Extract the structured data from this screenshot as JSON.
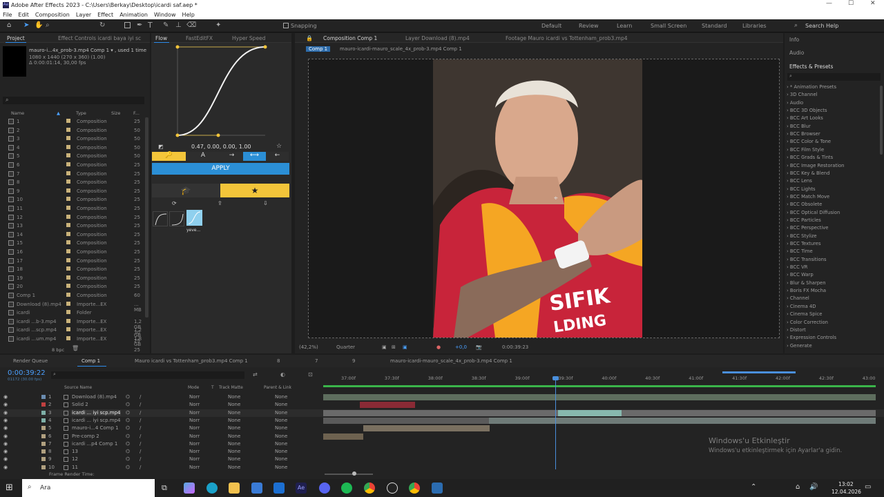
{
  "app": {
    "title": "Adobe After Effects 2023 - C:\\Users\\Berkay\\Desktop\\icardi saf.aep *"
  },
  "menu": [
    "File",
    "Edit",
    "Composition",
    "Layer",
    "Effect",
    "Animation",
    "Window",
    "Help"
  ],
  "toolbar": {
    "snapping": "Snapping",
    "workspaces": [
      "Default",
      "Review",
      "Learn",
      "Small Screen",
      "Standard",
      "Libraries"
    ],
    "search": "Search Help"
  },
  "project": {
    "tabs": [
      "Project",
      "Effect Controls icardi baya iyi sc"
    ],
    "item_name": "mauro-i...4x_prob-3.mp4 Comp 1 ▾ , used 1 time",
    "item_dims": "1080 x 1440 (270 x 360) (1.00)",
    "item_dur": "Δ 0:00:01:14, 30,00 fps",
    "cols": [
      "Name",
      "Type",
      "Size",
      "F..."
    ],
    "rows": [
      {
        "n": "1",
        "t": "Composition",
        "s": "25"
      },
      {
        "n": "2",
        "t": "Composition",
        "s": "50"
      },
      {
        "n": "3",
        "t": "Composition",
        "s": "50"
      },
      {
        "n": "4",
        "t": "Composition",
        "s": "50"
      },
      {
        "n": "5",
        "t": "Composition",
        "s": "50"
      },
      {
        "n": "6",
        "t": "Composition",
        "s": "25"
      },
      {
        "n": "7",
        "t": "Composition",
        "s": "25"
      },
      {
        "n": "8",
        "t": "Composition",
        "s": "25"
      },
      {
        "n": "9",
        "t": "Composition",
        "s": "25"
      },
      {
        "n": "10",
        "t": "Composition",
        "s": "25"
      },
      {
        "n": "11",
        "t": "Composition",
        "s": "25"
      },
      {
        "n": "12",
        "t": "Composition",
        "s": "25"
      },
      {
        "n": "13",
        "t": "Composition",
        "s": "25"
      },
      {
        "n": "14",
        "t": "Composition",
        "s": "25"
      },
      {
        "n": "15",
        "t": "Composition",
        "s": "25"
      },
      {
        "n": "16",
        "t": "Composition",
        "s": "25"
      },
      {
        "n": "17",
        "t": "Composition",
        "s": "25"
      },
      {
        "n": "18",
        "t": "Composition",
        "s": "25"
      },
      {
        "n": "19",
        "t": "Composition",
        "s": "25"
      },
      {
        "n": "20",
        "t": "Composition",
        "s": "25"
      },
      {
        "n": "Comp 1",
        "t": "Composition",
        "s": "60"
      },
      {
        "n": "Download (8).mp4",
        "t": "Importe...EX",
        "s": "... MB"
      },
      {
        "n": "icardi",
        "t": "Folder",
        "s": ""
      },
      {
        "n": "icardi ...b-3.mp4",
        "t": "Importe...EX",
        "s": "1,2 GB 30"
      },
      {
        "n": "icardi ...scp.mp4",
        "t": "Importe...EX",
        "s": "1,2 GB 25"
      },
      {
        "n": "icardi ...um.mp4",
        "t": "Importe...EX",
        "s": "1,8 GB 25"
      }
    ],
    "bpc": "8 bpc"
  },
  "flow": {
    "tabs": [
      "Flow",
      "FastEditFX",
      "Hyper Speed"
    ],
    "values": "0.47, 0.00, 0.00, 1.00",
    "apply": "APPLY",
    "preset_label": "yeve..."
  },
  "viewer": {
    "tabs": [
      "Composition Comp 1",
      "Layer Download (8).mp4",
      "Footage Mauro icardi vs Tottenham_prob3.mp4"
    ],
    "crumbs": [
      "Comp 1",
      "mauro-icardi-mauro_scale_4x_prob-3.mp4 Comp 1"
    ],
    "zoom": "(42,2%)",
    "quality": "Quarter",
    "exposure": "+0,0",
    "time": "0:00:39:23"
  },
  "effects": {
    "tabs": [
      "Info",
      "Audio",
      "Effects & Presets"
    ],
    "items": [
      "* Animation Presets",
      "3D Channel",
      "Audio",
      "BCC 3D Objects",
      "BCC Art Looks",
      "BCC Blur",
      "BCC Browser",
      "BCC Color & Tone",
      "BCC Film Style",
      "BCC Grads & Tints",
      "BCC Image Restoration",
      "BCC Key & Blend",
      "BCC Lens",
      "BCC Lights",
      "BCC Match Move",
      "BCC Obsolete",
      "BCC Optical Diffusion",
      "BCC Particles",
      "BCC Perspective",
      "BCC Stylize",
      "BCC Textures",
      "BCC Time",
      "BCC Transitions",
      "BCC VR",
      "BCC Warp",
      "Blur & Sharpen",
      "Boris FX Mocha",
      "Channel",
      "Cinema 4D",
      "Cinema Spice",
      "Color Correction",
      "Distort",
      "Expression Controls",
      "Generate"
    ]
  },
  "timeline": {
    "tabs": [
      "Render Queue",
      "Comp 1",
      "Mauro icardi vs Tottenham_prob3.mp4 Comp 1",
      "8",
      "7",
      "9",
      "mauro-icardi-mauro_scale_4x_prob-3.mp4 Comp 1"
    ],
    "current": "0:00:39:22",
    "fps": "01172 (30.00 fps)",
    "cols": [
      "Source Name",
      "Mode",
      "T",
      "Track Matte",
      "Parent & Link"
    ],
    "ticks": [
      "37:00f",
      "37:30f",
      "38:00f",
      "38:30f",
      "39:00f",
      "39:30f",
      "40:00f",
      "40:30f",
      "41:00f",
      "41:30f",
      "42:00f",
      "42:30f",
      "43:00"
    ],
    "layers": [
      {
        "n": "1",
        "name": "Download (8).mp4",
        "mode": "Norr",
        "tm": "None",
        "par": "None",
        "color": "#6b8cb0"
      },
      {
        "n": "2",
        "name": "Solid 2",
        "mode": "Norr",
        "tm": "None",
        "par": "None",
        "color": "#c04040"
      },
      {
        "n": "3",
        "name": "icardi ... iyi scp.mp4",
        "mode": "Norr",
        "tm": "None",
        "par": "None",
        "color": "#7fb0a8"
      },
      {
        "n": "4",
        "name": "icardi ... iyi scp.mp4",
        "mode": "Norr",
        "tm": "None",
        "par": "None",
        "color": "#7fb0a8"
      },
      {
        "n": "5",
        "name": "mauro-i...4 Comp 1",
        "mode": "Norr",
        "tm": "None",
        "par": "None",
        "color": "#b0a080"
      },
      {
        "n": "6",
        "name": "Pre-comp 2",
        "mode": "Norr",
        "tm": "None",
        "par": "None",
        "color": "#b0a080"
      },
      {
        "n": "7",
        "name": "icardi ...p4 Comp 1",
        "mode": "Norr",
        "tm": "None",
        "par": "None",
        "color": "#b0a080"
      },
      {
        "n": "8",
        "name": "13",
        "mode": "Norr",
        "tm": "None",
        "par": "None",
        "color": "#b0a080"
      },
      {
        "n": "9",
        "name": "12",
        "mode": "Norr",
        "tm": "None",
        "par": "None",
        "color": "#b0a080"
      },
      {
        "n": "10",
        "name": "11",
        "mode": "Norr",
        "tm": "None",
        "par": "None",
        "color": "#b0a080"
      }
    ],
    "render_time": "Frame Render Time: "
  },
  "watermark": {
    "line1": "Windows'u Etkinleştir",
    "line2": "Windows'u etkinleştirmek için Ayarlar'a gidin."
  },
  "taskbar": {
    "search": "Ara",
    "time": "13:02",
    "date": "12.04.2026"
  }
}
